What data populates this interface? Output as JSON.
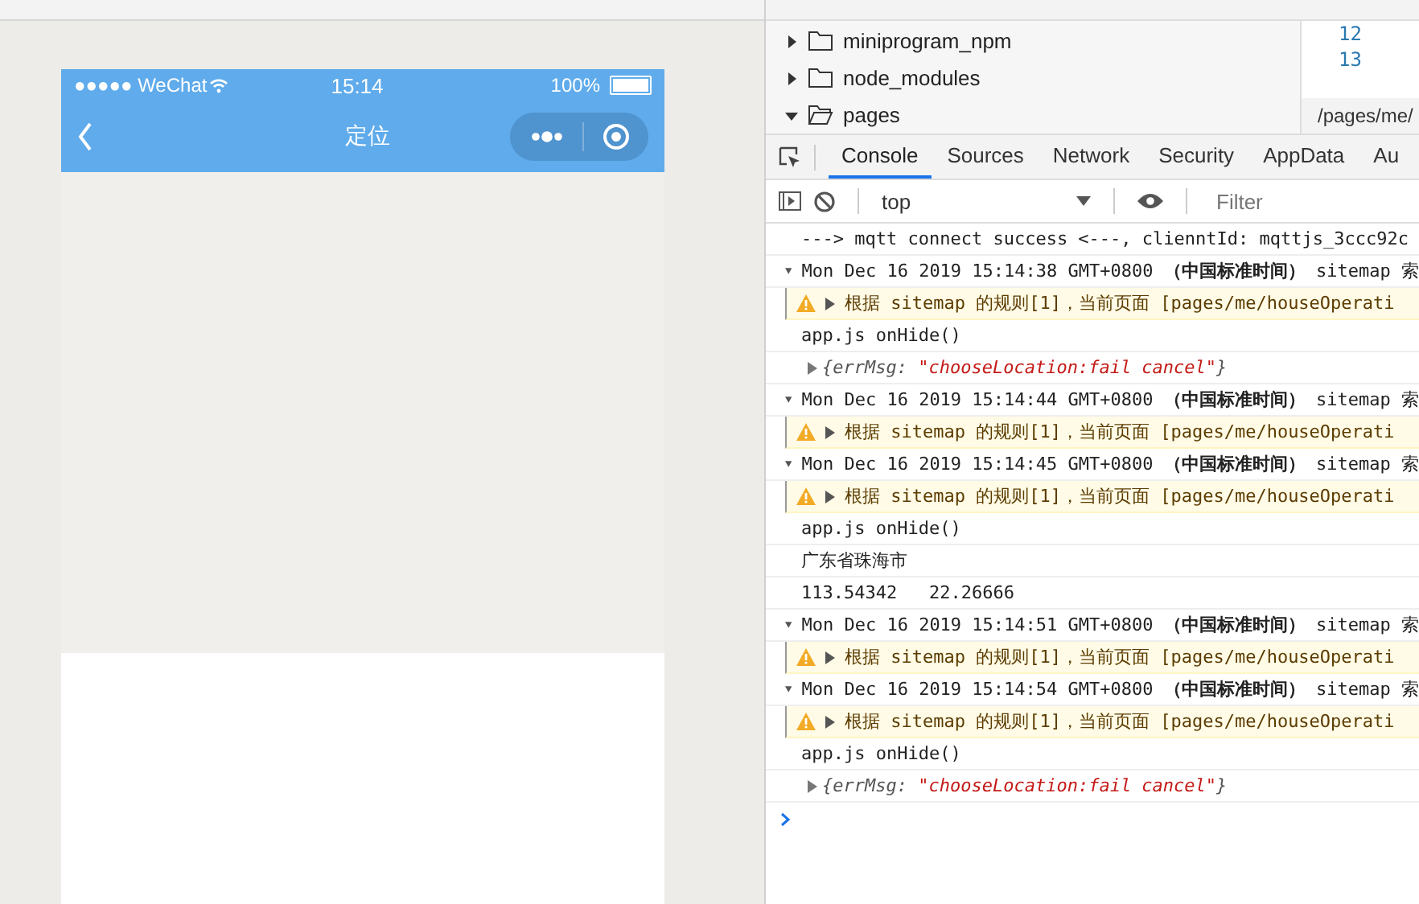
{
  "phone": {
    "status": {
      "carrier": "●●●●● WeChat",
      "time": "15:14",
      "battery": "100%"
    },
    "nav": {
      "title": "定位"
    }
  },
  "file_tree": [
    {
      "name": "miniprogram_npm",
      "expanded": false
    },
    {
      "name": "node_modules",
      "expanded": false
    },
    {
      "name": "pages",
      "expanded": true
    }
  ],
  "editor": {
    "line_numbers": [
      "12",
      "13"
    ],
    "path": "/pages/me/"
  },
  "devtools_tabs": [
    {
      "label": "Console",
      "selected": true
    },
    {
      "label": "Sources",
      "selected": false
    },
    {
      "label": "Network",
      "selected": false
    },
    {
      "label": "Security",
      "selected": false
    },
    {
      "label": "AppData",
      "selected": false
    },
    {
      "label": "Au",
      "selected": false
    }
  ],
  "console_toolbar": {
    "context": "top",
    "filter": {
      "placeholder": "Filter"
    }
  },
  "console": [
    {
      "kind": "log",
      "text": "---> mqtt connect success <---, clienntId: mqttjs_3ccc92c"
    },
    {
      "kind": "group",
      "text": "Mon Dec 16 2019 15:14:38 GMT+0800 **（中国标准时间）** sitemap 索"
    },
    {
      "kind": "warn",
      "text": "根据 sitemap 的规则[1]，当前页面 [pages/me/houseOperati"
    },
    {
      "kind": "log",
      "text": "app.js onHide()"
    },
    {
      "kind": "object",
      "key": "{errMsg: ",
      "value": "\"chooseLocation:fail cancel\"",
      "close": "}"
    },
    {
      "kind": "group",
      "text": "Mon Dec 16 2019 15:14:44 GMT+0800 **（中国标准时间）** sitemap 索"
    },
    {
      "kind": "warn",
      "text": "根据 sitemap 的规则[1]，当前页面 [pages/me/houseOperati"
    },
    {
      "kind": "group",
      "text": "Mon Dec 16 2019 15:14:45 GMT+0800 **（中国标准时间）** sitemap 索"
    },
    {
      "kind": "warn",
      "text": "根据 sitemap 的规则[1]，当前页面 [pages/me/houseOperati"
    },
    {
      "kind": "log",
      "text": "app.js onHide()"
    },
    {
      "kind": "log",
      "text": "广东省珠海市"
    },
    {
      "kind": "log",
      "text": "113.54342   22.26666"
    },
    {
      "kind": "group",
      "text": "Mon Dec 16 2019 15:14:51 GMT+0800 **（中国标准时间）** sitemap 索"
    },
    {
      "kind": "warn",
      "text": "根据 sitemap 的规则[1]，当前页面 [pages/me/houseOperati"
    },
    {
      "kind": "group",
      "text": "Mon Dec 16 2019 15:14:54 GMT+0800 **（中国标准时间）** sitemap 索"
    },
    {
      "kind": "warn",
      "text": "根据 sitemap 的规则[1]，当前页面 [pages/me/houseOperati"
    },
    {
      "kind": "log",
      "text": "app.js onHide()"
    },
    {
      "kind": "object",
      "key": "{errMsg: ",
      "value": "\"chooseLocation:fail cancel\"",
      "close": "}"
    }
  ]
}
